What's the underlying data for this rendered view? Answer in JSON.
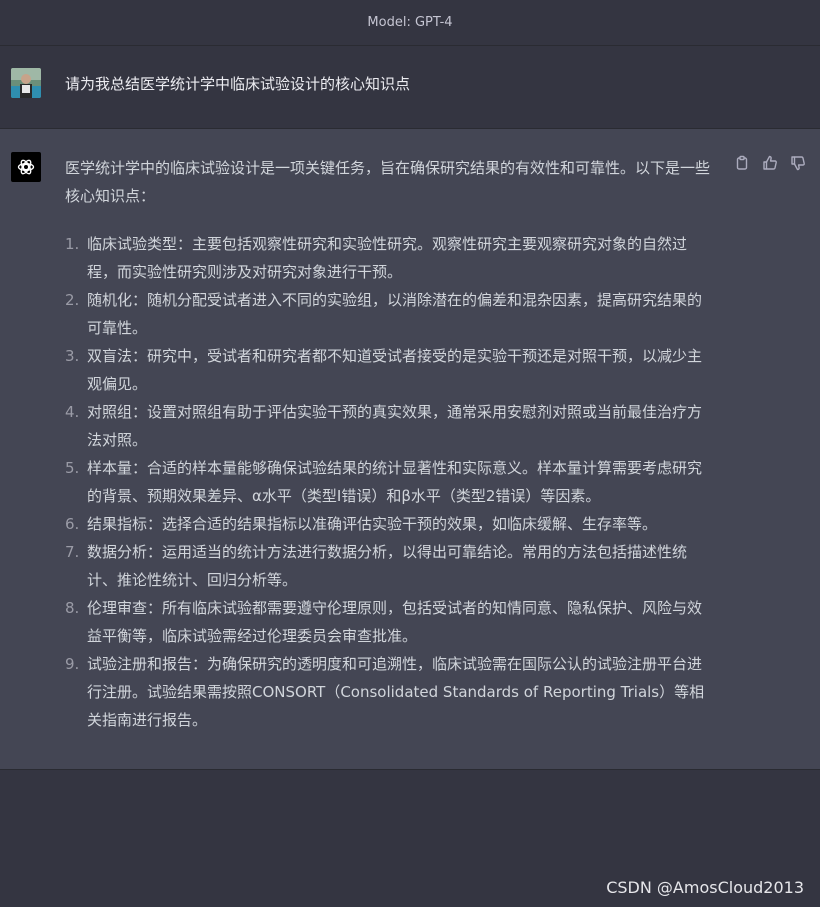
{
  "header": {
    "model_label": "Model: GPT-4"
  },
  "user": {
    "avatar": "user-photo-avatar",
    "message": "请为我总结医学统计学中临床试验设计的核心知识点"
  },
  "assistant": {
    "avatar": "openai-logo-icon",
    "intro": "医学统计学中的临床试验设计是一项关键任务，旨在确保研究结果的有效性和可靠性。以下是一些核心知识点：",
    "points": [
      {
        "num": "1.",
        "text": "临床试验类型：主要包括观察性研究和实验性研究。观察性研究主要观察研究对象的自然过程，而实验性研究则涉及对研究对象进行干预。"
      },
      {
        "num": "2.",
        "text": "随机化：随机分配受试者进入不同的实验组，以消除潜在的偏差和混杂因素，提高研究结果的可靠性。"
      },
      {
        "num": "3.",
        "text": "双盲法：研究中，受试者和研究者都不知道受试者接受的是实验干预还是对照干预，以减少主观偏见。"
      },
      {
        "num": "4.",
        "text": "对照组：设置对照组有助于评估实验干预的真实效果，通常采用安慰剂对照或当前最佳治疗方法对照。"
      },
      {
        "num": "5.",
        "text": "样本量：合适的样本量能够确保试验结果的统计显著性和实际意义。样本量计算需要考虑研究的背景、预期效果差异、α水平（类型I错误）和β水平（类型2错误）等因素。"
      },
      {
        "num": "6.",
        "text": "结果指标：选择合适的结果指标以准确评估实验干预的效果，如临床缓解、生存率等。"
      },
      {
        "num": "7.",
        "text": "数据分析：运用适当的统计方法进行数据分析，以得出可靠结论。常用的方法包括描述性统计、推论性统计、回归分析等。"
      },
      {
        "num": "8.",
        "text": "伦理审查：所有临床试验都需要遵守伦理原则，包括受试者的知情同意、隐私保护、风险与效益平衡等，临床试验需经过伦理委员会审查批准。"
      },
      {
        "num": "9.",
        "text": "试验注册和报告：为确保研究的透明度和可追溯性，临床试验需在国际公认的试验注册平台进行注册。试验结果需按照CONSORT（Consolidated Standards of Reporting Trials）等相关指南进行报告。"
      }
    ],
    "actions": [
      "copy-icon",
      "thumbs-up-icon",
      "thumbs-down-icon"
    ]
  },
  "watermark": "CSDN @AmosCloud2013"
}
